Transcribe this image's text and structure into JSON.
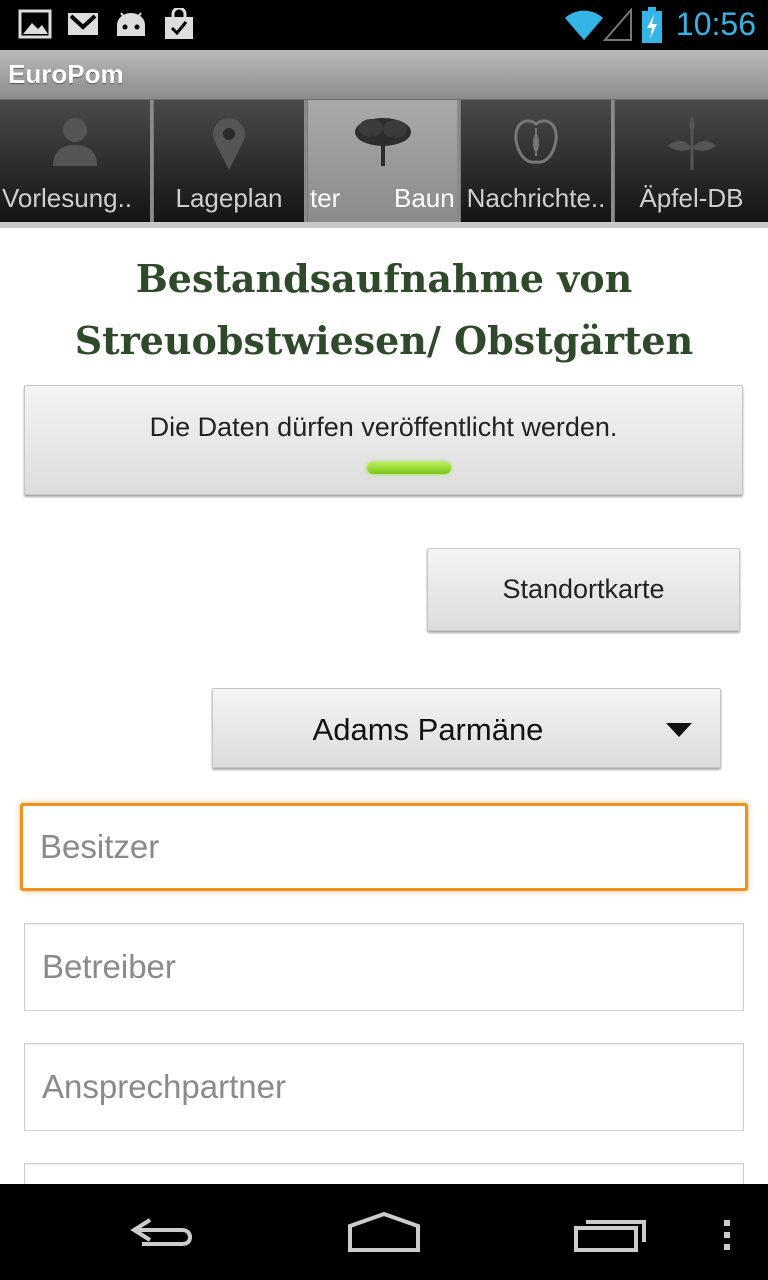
{
  "status_bar": {
    "time": "10:56",
    "notification_icons": [
      "gallery-icon",
      "gmail-icon",
      "android-debug-icon",
      "store-bag-icon"
    ],
    "system_icons": [
      "wifi-icon",
      "signal-icon",
      "battery-charging-icon"
    ],
    "accent_color": "#33b5e5"
  },
  "app": {
    "title": "EuroPom"
  },
  "tabs": [
    {
      "label": "Vorlesung..",
      "icon": "person-icon",
      "selected": false
    },
    {
      "label": "Lageplan",
      "icon": "map-pin-icon",
      "selected": false
    },
    {
      "label": "ter",
      "label_b": "Baun",
      "icon": "tree-icon",
      "selected": true
    },
    {
      "label": "Nachrichte..",
      "icon": "apple-outline-icon",
      "selected": false
    },
    {
      "label": "Äpfel-DB",
      "icon": "plant-icon",
      "selected": false
    }
  ],
  "main": {
    "heading_line1": "Bestandsaufnahme von",
    "heading_line2": "Streuobstwiesen/ Obstgärten",
    "publish_toggle": {
      "label": "Die Daten dürfen veröffentlicht werden.",
      "state": "on",
      "indicator_color": "#99cc33"
    },
    "map_button": "Standortkarte",
    "variety_spinner": {
      "value": "Adams Parmäne"
    },
    "fields": [
      {
        "placeholder": "Besitzer",
        "focused": true
      },
      {
        "placeholder": "Betreiber",
        "focused": false
      },
      {
        "placeholder": "Ansprechpartner",
        "focused": false
      }
    ],
    "focus_color": "#f0901d"
  },
  "nav_bar": {
    "buttons": [
      "back-icon",
      "home-icon",
      "recent-apps-icon",
      "overflow-menu-icon"
    ]
  }
}
